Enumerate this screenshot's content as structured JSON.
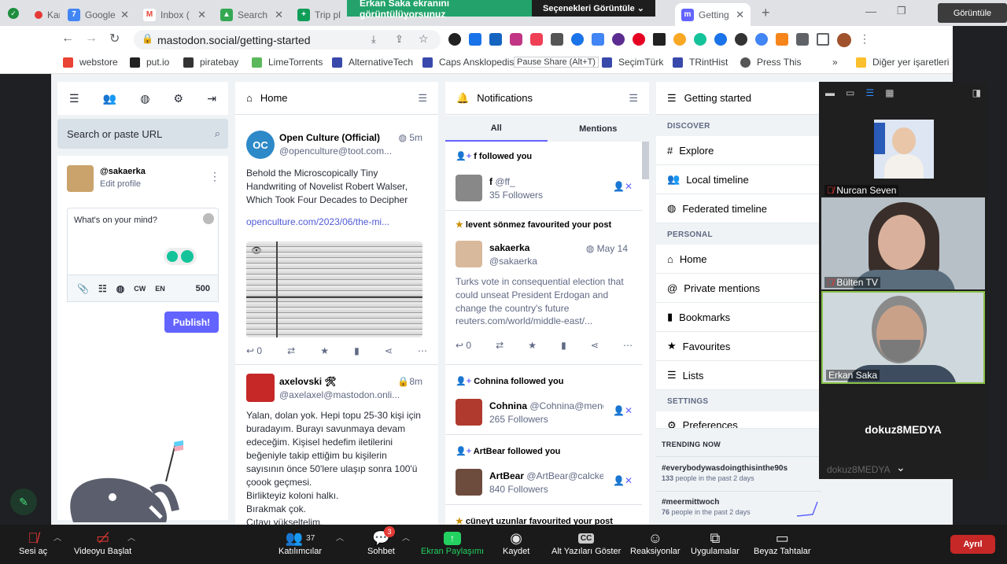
{
  "browser": {
    "tabs": [
      {
        "label": "Kar",
        "color": "#e53935"
      },
      {
        "label": "Google",
        "color": "#4285f4"
      },
      {
        "label": "Inbox (",
        "color": "#ea4335"
      },
      {
        "label": "Search",
        "color": "#34a853"
      },
      {
        "label": "Trip pl",
        "color": "#0f9d58"
      },
      {
        "label": "Getting",
        "color": "#6364ff"
      }
    ],
    "url": "mastodon.social/getting-started",
    "share_banner": "Erkan Saka ekranını görüntülüyorsunuz",
    "share_options": "Seçenekleri Görüntüle",
    "top_right": "Görüntüle",
    "bookmarks": [
      {
        "label": "webstore",
        "color": "#e94335"
      },
      {
        "label": "put.io",
        "color": "#222222"
      },
      {
        "label": "piratebay",
        "color": "#333333"
      },
      {
        "label": "LimeTorrents",
        "color": "#5cb85c"
      },
      {
        "label": "AlternativeTech",
        "color": "#3949ab"
      },
      {
        "label": "Caps Ansklopedisi",
        "color": "#3949ab"
      },
      {
        "label": "SeçimTürk",
        "color": "#3949ab"
      },
      {
        "label": "TRintHist",
        "color": "#3949ab"
      },
      {
        "label": "Press This",
        "color": "#555555"
      }
    ],
    "tooltip": "Pause Share (Alt+T)",
    "other_bookmarks": "Diğer yer işaretleri"
  },
  "compose": {
    "search_placeholder": "Search or paste URL",
    "username": "@sakaerka",
    "edit_profile": "Edit profile",
    "textarea_placeholder": "What's on your mind?",
    "cw": "CW",
    "lang": "EN",
    "char_count": "500",
    "publish": "Publish!"
  },
  "home": {
    "title": "Home",
    "posts": [
      {
        "name": "Open Culture (Official)",
        "handle": "@openculture@toot.com...",
        "time": "5m",
        "text": "Behold the Microscopically Tiny Handwriting of Novelist Robert Walser, Which Took Four Decades to Decipher",
        "link": "openculture.com/2023/06/the-mi...",
        "replies": "0",
        "avatar_text": "OC"
      },
      {
        "name": "axelovski 🛠",
        "handle": "@axelaxel@mastodon.onli...",
        "time": "8m",
        "lines": [
          "Yalan, dolan yok. Hepi topu 25-30 kişi için buradayım. Burayı savunmaya devam edeceğim. Kişisel hedefim iletilerini beğeniyle takip ettiğim bu kişilerin sayısının önce 50'lere ulaşıp sonra 100'ü çoook geçmesi.",
          "Birlikteyiz koloni halkı.",
          "Bırakmak çok.",
          "Çıtayı yükseltelim."
        ]
      }
    ]
  },
  "notifications": {
    "title": "Notifications",
    "tab_all": "All",
    "tab_mentions": "Mentions",
    "items": [
      {
        "headline": "f followed you",
        "name": "f",
        "handle": "@ff_",
        "followers": "35 Followers"
      },
      {
        "headline": "levent sönmez favourited your post",
        "name": "sakaerka",
        "handle": "@sakaerka",
        "date": "May 14",
        "text": "Turks vote in consequential election that could unseat President Erdogan and change the country's future",
        "link": "reuters.com/world/middle-east/...",
        "replies": "0"
      },
      {
        "headline": "Cohnina followed you",
        "name": "Cohnina",
        "handle": "@Cohnina@mendedc",
        "followers": "265 Followers"
      },
      {
        "headline": "ArtBear followed you",
        "name": "ArtBear",
        "handle": "@ArtBear@calckey.sc",
        "followers": "840 Followers"
      },
      {
        "headline": "cüneyt uzunlar favourited your post"
      }
    ]
  },
  "getting_started": {
    "title": "Getting started",
    "discover": "DISCOVER",
    "explore": "Explore",
    "local": "Local timeline",
    "federated": "Federated timeline",
    "personal": "PERSONAL",
    "home": "Home",
    "private": "Private mentions",
    "bookmarks": "Bookmarks",
    "favourites": "Favourites",
    "lists": "Lists",
    "settings": "SETTINGS",
    "preferences": "Preferences",
    "trending_title": "TRENDING NOW",
    "trends": [
      {
        "tag": "#everybodywasdoingthisinthe90s",
        "count": "133",
        "suffix": " people in the past 2 days"
      },
      {
        "tag": "#meermittwoch",
        "count": "76",
        "suffix": " people in the past 2 days"
      }
    ]
  },
  "zoom": {
    "participants": [
      {
        "name": "Nurcan Seven"
      },
      {
        "name": "Bülten TV"
      },
      {
        "name": "Erkan Saka"
      }
    ],
    "brand": "dokuz8MEDYA",
    "brand_small": "dokuz8MEDYA",
    "toolbar": {
      "mute": "Sesi aç",
      "video": "Videoyu Başlat",
      "participants": "Katılımcılar",
      "participants_count": "37",
      "chat": "Sohbet",
      "chat_badge": "3",
      "share": "Ekran Paylaşımı",
      "record": "Kaydet",
      "captions": "Alt Yazıları Göster",
      "reactions": "Reaksiyonlar",
      "apps": "Uygulamalar",
      "whiteboard": "Beyaz Tahtalar",
      "leave": "Ayrıl"
    }
  }
}
